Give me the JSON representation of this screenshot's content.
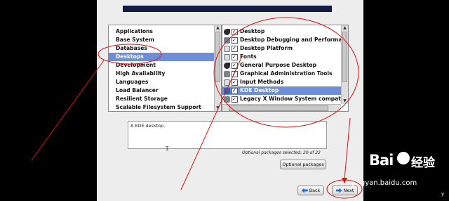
{
  "groups": {
    "items": [
      {
        "label": "Applications"
      },
      {
        "label": "Base System"
      },
      {
        "label": "Databases"
      },
      {
        "label": "Desktops",
        "selected": true
      },
      {
        "label": "Development"
      },
      {
        "label": "High Availability"
      },
      {
        "label": "Languages"
      },
      {
        "label": "Load Balancer"
      },
      {
        "label": "Resilient Storage"
      },
      {
        "label": "Scalable Filesystem Support"
      }
    ]
  },
  "packages": {
    "items": [
      {
        "label": "Desktop",
        "icon": "gnome-foot-icon",
        "checked": true
      },
      {
        "label": "Desktop Debugging and Performa",
        "icon": "debug-tools-icon",
        "checked": true
      },
      {
        "label": "Desktop Platform",
        "icon": "platform-icon",
        "checked": true
      },
      {
        "label": "Fonts",
        "icon": "font-icon",
        "checked": true
      },
      {
        "label": "General Purpose Desktop",
        "icon": "gnome-foot-icon",
        "checked": true
      },
      {
        "label": "Graphical Administration Tools",
        "icon": "admin-tools-icon",
        "checked": true
      },
      {
        "label": "Input Methods",
        "icon": "input-methods-icon",
        "checked": true
      },
      {
        "label": "KDE Desktop",
        "icon": "kde-icon",
        "checked": true,
        "selected": true
      },
      {
        "label": "Legacy X Window System compat",
        "icon": "x-window-icon",
        "checked": true
      }
    ]
  },
  "description": "A KDE desktop.",
  "optional_status": "Optional packages selected: 20 of 22",
  "buttons": {
    "optional": "Optional packages",
    "back": "Back",
    "next": "Next"
  },
  "watermark": {
    "logo": "Bai",
    "cn": "经验",
    "url": "jingyan.baidu.com",
    "edge": "y"
  },
  "colors": {
    "selection": "#6e8fd8",
    "annotation": "#e01010",
    "banner": "#141c44"
  }
}
